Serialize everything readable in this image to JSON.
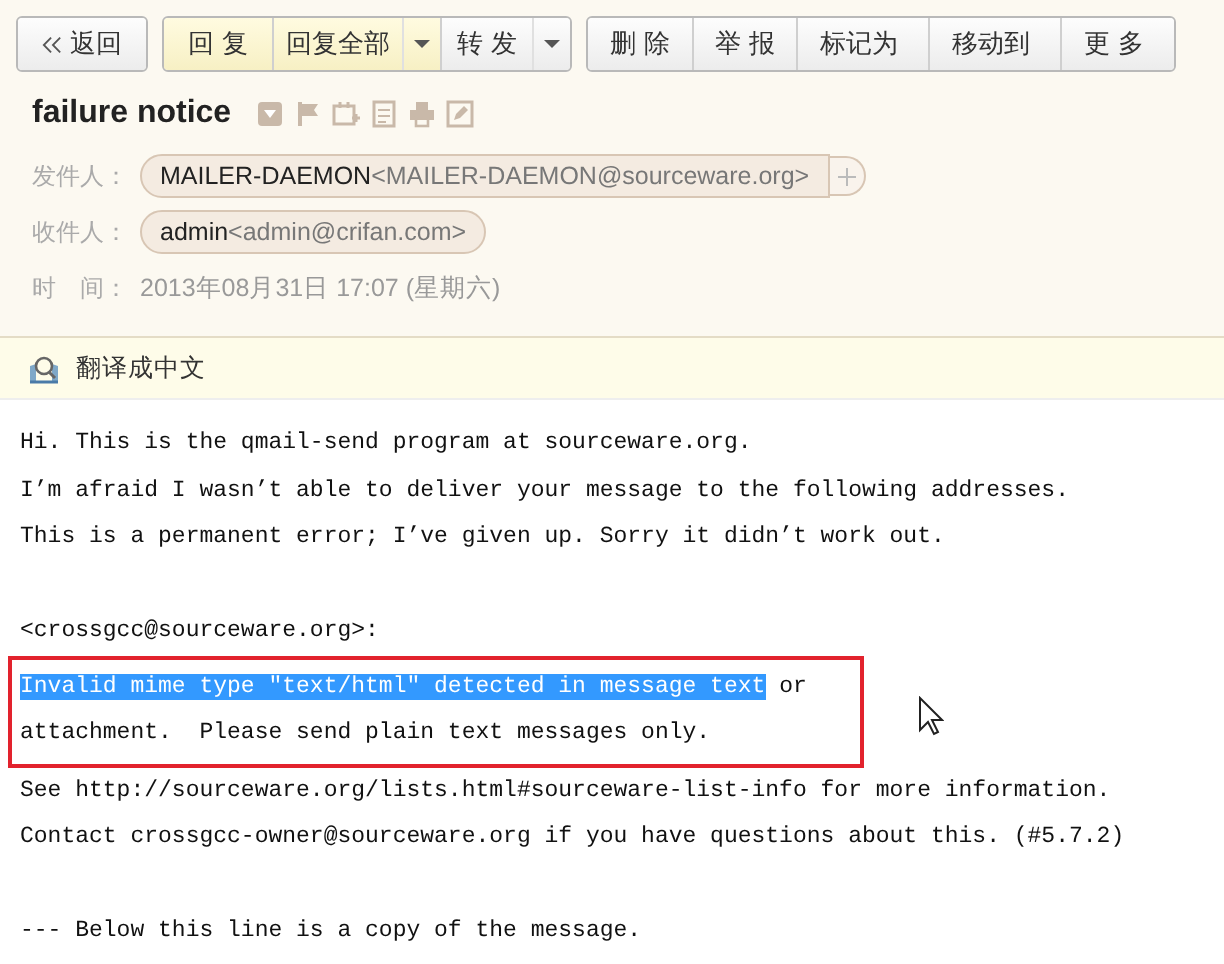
{
  "toolbar": [
    {
      "buttons": [
        {
          "kind": "back",
          "label": "返回",
          "highlighted": false
        }
      ]
    },
    {
      "buttons": [
        {
          "kind": "button",
          "label": "回 复",
          "highlighted": true
        },
        {
          "kind": "button",
          "label": "回复全部",
          "highlighted": true
        },
        {
          "kind": "split-caret",
          "highlighted": true
        },
        {
          "kind": "button",
          "label": "转 发",
          "highlighted": false
        },
        {
          "kind": "split-caret",
          "highlighted": false
        }
      ]
    },
    {
      "buttons": [
        {
          "kind": "button",
          "label": "删 除",
          "highlighted": false
        },
        {
          "kind": "button",
          "label": "举 报",
          "highlighted": false
        },
        {
          "kind": "menu",
          "label": "标记为",
          "highlighted": false
        },
        {
          "kind": "menu",
          "label": "移动到",
          "highlighted": false
        },
        {
          "kind": "menu",
          "label": "更 多",
          "highlighted": false
        }
      ]
    }
  ],
  "message": {
    "subject": "failure notice",
    "fields": [
      {
        "kind": "contact",
        "label": "发件人：",
        "name": "MAILER-DAEMON",
        "address": "<MAILER-DAEMON@sourceware.org>",
        "addable": true
      },
      {
        "kind": "contact",
        "label": "收件人：",
        "name": "admin",
        "address": "<admin@crifan.com>",
        "addable": false
      },
      {
        "kind": "text",
        "label": "时　间：",
        "value": "2013年08月31日 17:07 (星期六)"
      }
    ]
  },
  "translate_bar": {
    "label": "翻译成中文"
  },
  "body": [
    {
      "kind": "line",
      "segments": [
        {
          "text": "Hi. This is the qmail-send program at sourceware.org.",
          "selected": false
        }
      ]
    },
    {
      "kind": "line",
      "segments": [
        {
          "text": "I’m afraid I wasn’t able to deliver your message to the following addresses.",
          "selected": false
        }
      ]
    },
    {
      "kind": "line",
      "segments": [
        {
          "text": "This is a permanent error; I’ve given up. Sorry it didn’t work out.",
          "selected": false
        }
      ]
    },
    {
      "kind": "gap"
    },
    {
      "kind": "line",
      "segments": [
        {
          "text": "<crossgcc@sourceware.org>:",
          "selected": false
        }
      ]
    },
    {
      "kind": "boxed",
      "lines": [
        {
          "segments": [
            {
              "text": "Invalid mime type ″text/html″ detected in message text",
              "selected": true
            },
            {
              "text": " or",
              "selected": false
            }
          ]
        },
        {
          "segments": [
            {
              "text": "attachment.  Please send plain text messages only.",
              "selected": false
            }
          ]
        }
      ]
    },
    {
      "kind": "line",
      "segments": [
        {
          "text": "See http://sourceware.org/lists.html#sourceware-list-info for more information.",
          "selected": false
        }
      ]
    },
    {
      "kind": "line",
      "segments": [
        {
          "text": "Contact crossgcc-owner@sourceware.org if you have questions about this. (#5.7.2)",
          "selected": false
        }
      ]
    },
    {
      "kind": "gap"
    },
    {
      "kind": "line",
      "segments": [
        {
          "text": "--- Below this line is a copy of the message.",
          "selected": false
        }
      ]
    }
  ]
}
